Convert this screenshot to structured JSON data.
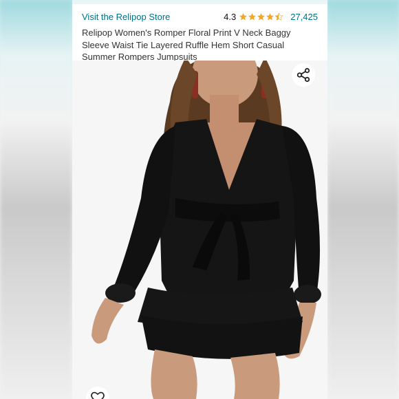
{
  "store": {
    "link_text": "Visit the Relipop Store"
  },
  "rating": {
    "value": "4.3",
    "stars": 4.3,
    "count": "27,425"
  },
  "product": {
    "title": "Relipop Women's Romper Floral Print V Neck Baggy Sleeve Waist Tie Layered Ruffle Hem Short Casual Summer Rompers Jumpsuits"
  },
  "icons": {
    "share": "share-icon",
    "wishlist": "heart-icon",
    "star": "star-icon"
  },
  "colors": {
    "link": "#007185",
    "star": "#f5a623",
    "dress": "#111111"
  }
}
